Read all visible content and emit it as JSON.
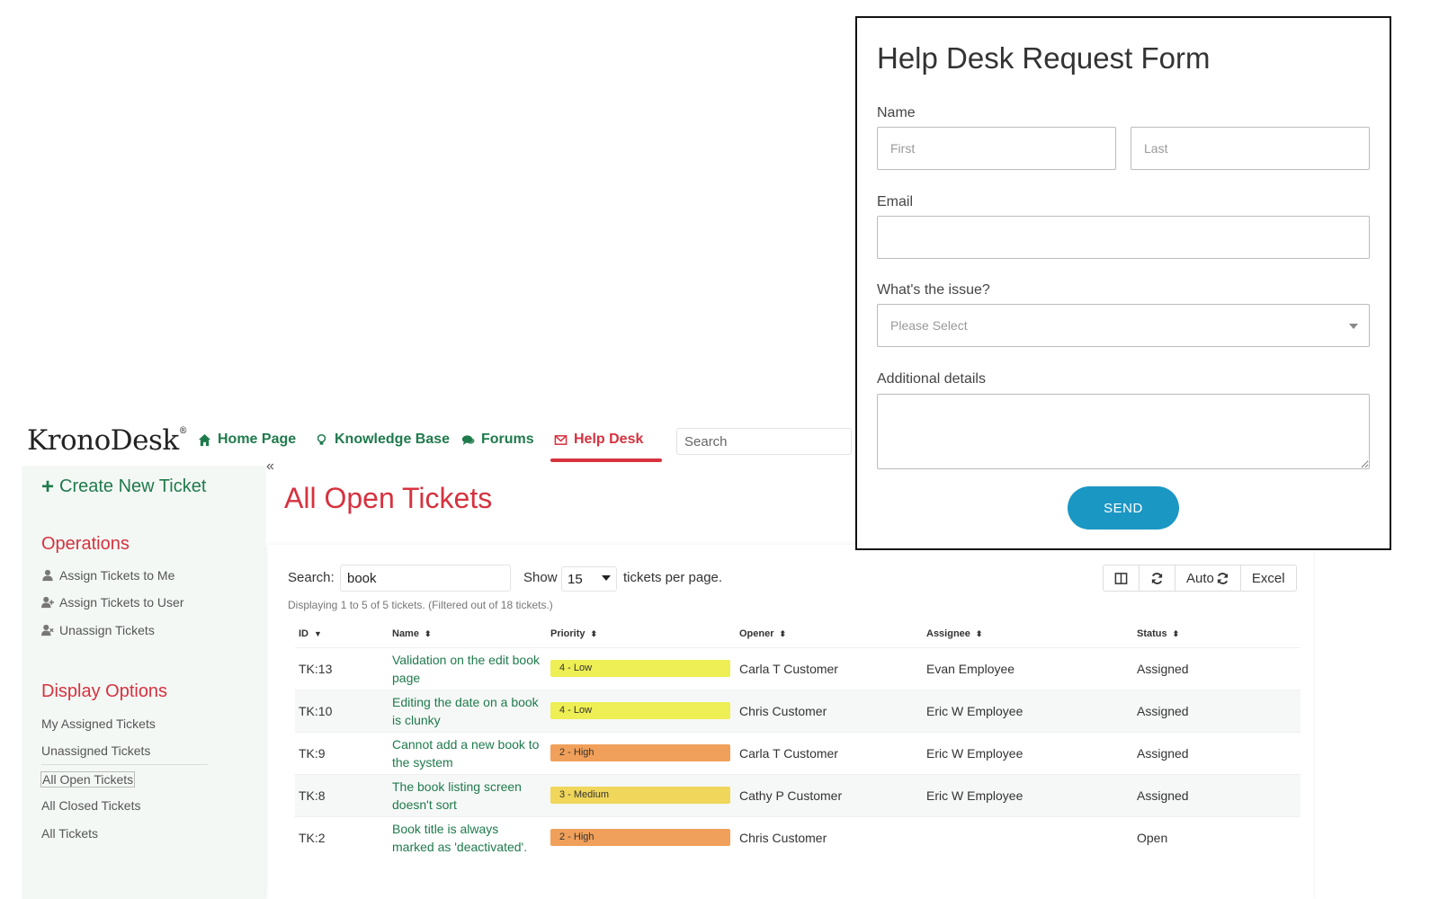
{
  "brand": {
    "logo_main": "KronoDesk",
    "logo_mark": "®"
  },
  "nav": {
    "items": [
      {
        "label": "Home Page",
        "icon": "home-icon"
      },
      {
        "label": "Knowledge Base",
        "icon": "lightbulb-icon"
      },
      {
        "label": "Forums",
        "icon": "comments-icon"
      },
      {
        "label": "Help Desk",
        "icon": "envelope-icon"
      }
    ],
    "active": "Help Desk",
    "search_placeholder": "Search"
  },
  "sidebar": {
    "create_label": "Create New Ticket",
    "operations_title": "Operations",
    "operations": [
      {
        "label": "Assign Tickets to Me",
        "icon": "user-icon"
      },
      {
        "label": "Assign Tickets to User",
        "icon": "user-plus-icon"
      },
      {
        "label": "Unassign Tickets",
        "icon": "user-times-icon"
      }
    ],
    "display_title": "Display Options",
    "display": [
      {
        "label": "My Assigned Tickets"
      },
      {
        "label": "Unassigned Tickets"
      },
      {
        "label": "All Open Tickets",
        "current": true
      },
      {
        "label": "All Closed Tickets"
      },
      {
        "label": "All Tickets"
      }
    ],
    "collapse_glyph": "«"
  },
  "main": {
    "title": "All Open Tickets",
    "search_label": "Search:",
    "search_value": "book",
    "show_label": "Show",
    "show_value": "15",
    "per_page_label": "tickets per page.",
    "toolbar": {
      "auto_label": "Auto",
      "excel_label": "Excel"
    },
    "displaying": "Displaying 1 to 5 of 5 tickets. (Filtered out of 18 tickets.)",
    "columns": [
      "ID",
      "Name",
      "Priority",
      "Opener",
      "Assignee",
      "Status"
    ],
    "rows": [
      {
        "id": "TK:13",
        "name": "Validation on the edit book page",
        "priority": "4 - Low",
        "opener": "Carla T Customer",
        "assignee": "Evan Employee",
        "status": "Assigned"
      },
      {
        "id": "TK:10",
        "name": "Editing the date on a book is clunky",
        "priority": "4 - Low",
        "opener": "Chris Customer",
        "assignee": "Eric W Employee",
        "status": "Assigned"
      },
      {
        "id": "TK:9",
        "name": "Cannot add a new book to the system",
        "priority": "2 - High",
        "opener": "Carla T Customer",
        "assignee": "Eric W Employee",
        "status": "Assigned"
      },
      {
        "id": "TK:8",
        "name": "The book listing screen doesn't sort",
        "priority": "3 - Medium",
        "opener": "Cathy P Customer",
        "assignee": "Eric W Employee",
        "status": "Assigned"
      },
      {
        "id": "TK:2",
        "name": "Book title is always marked as 'deactivated'.",
        "priority": "2 - High",
        "opener": "Chris Customer",
        "assignee": "",
        "status": "Open"
      }
    ],
    "priority_colors": {
      "4 - Low": "#eeee55",
      "3 - Medium": "#f0d65a",
      "2 - High": "#f0a05a"
    }
  },
  "form": {
    "title": "Help Desk Request Form",
    "name_label": "Name",
    "first_placeholder": "First",
    "last_placeholder": "Last",
    "email_label": "Email",
    "issue_label": "What's the issue?",
    "issue_placeholder": "Please Select",
    "details_label": "Additional details",
    "send_label": "SEND"
  },
  "colors": {
    "brand_green": "#1f7a4c",
    "accent_red": "#d6323f",
    "send_blue": "#1b97c4"
  }
}
